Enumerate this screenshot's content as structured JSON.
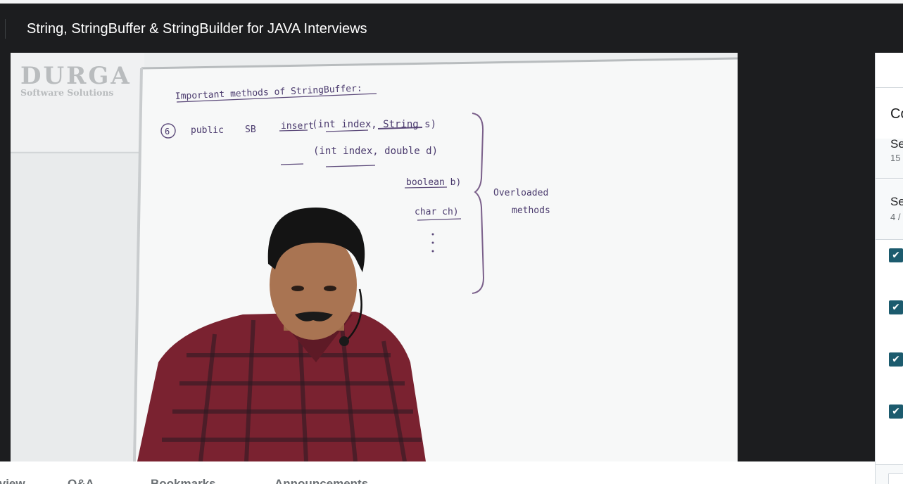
{
  "header": {
    "course_title": "String, StringBuffer & StringBuilder for JAVA Interviews"
  },
  "video": {
    "watermark_title": "DURGA",
    "watermark_subtitle": "Software Solutions",
    "board": {
      "heading": "Important methods of StringBuffer:",
      "item_number": "6",
      "modifier": "public",
      "return_type": "SB",
      "method": "insert",
      "params_line1": "(int index, String s)",
      "params_line2": "(int index, double d)",
      "params_line3": "boolean b)",
      "params_line4": "char ch)",
      "note_line1": "Overloaded",
      "note_line2": "methods"
    }
  },
  "sidebar": {
    "heading": "Co",
    "sections": [
      {
        "title": "Se",
        "meta": "15"
      },
      {
        "title": "Se",
        "meta": "4 /"
      }
    ],
    "items": [
      {
        "checked": true
      },
      {
        "checked": true
      },
      {
        "checked": true
      },
      {
        "checked": true
      }
    ],
    "check_glyph": "✔"
  },
  "tabs": [
    {
      "label": "Overview"
    },
    {
      "label": "Q&A"
    },
    {
      "label": "Bookmarks"
    },
    {
      "label": "Announcements"
    }
  ],
  "colors": {
    "header_bg": "#1c1d1f",
    "checkbox": "#1c5b6e"
  }
}
